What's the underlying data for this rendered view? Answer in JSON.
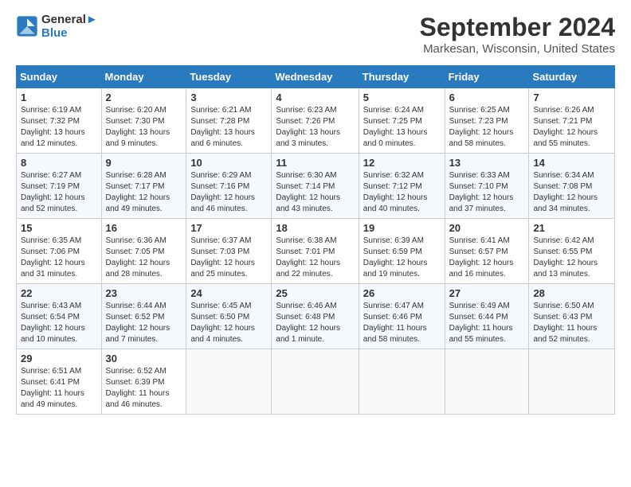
{
  "header": {
    "logo_line1": "General",
    "logo_line2": "Blue",
    "month_year": "September 2024",
    "location": "Markesan, Wisconsin, United States"
  },
  "weekdays": [
    "Sunday",
    "Monday",
    "Tuesday",
    "Wednesday",
    "Thursday",
    "Friday",
    "Saturday"
  ],
  "weeks": [
    [
      {
        "day": "1",
        "info": "Sunrise: 6:19 AM\nSunset: 7:32 PM\nDaylight: 13 hours\nand 12 minutes."
      },
      {
        "day": "2",
        "info": "Sunrise: 6:20 AM\nSunset: 7:30 PM\nDaylight: 13 hours\nand 9 minutes."
      },
      {
        "day": "3",
        "info": "Sunrise: 6:21 AM\nSunset: 7:28 PM\nDaylight: 13 hours\nand 6 minutes."
      },
      {
        "day": "4",
        "info": "Sunrise: 6:23 AM\nSunset: 7:26 PM\nDaylight: 13 hours\nand 3 minutes."
      },
      {
        "day": "5",
        "info": "Sunrise: 6:24 AM\nSunset: 7:25 PM\nDaylight: 13 hours\nand 0 minutes."
      },
      {
        "day": "6",
        "info": "Sunrise: 6:25 AM\nSunset: 7:23 PM\nDaylight: 12 hours\nand 58 minutes."
      },
      {
        "day": "7",
        "info": "Sunrise: 6:26 AM\nSunset: 7:21 PM\nDaylight: 12 hours\nand 55 minutes."
      }
    ],
    [
      {
        "day": "8",
        "info": "Sunrise: 6:27 AM\nSunset: 7:19 PM\nDaylight: 12 hours\nand 52 minutes."
      },
      {
        "day": "9",
        "info": "Sunrise: 6:28 AM\nSunset: 7:17 PM\nDaylight: 12 hours\nand 49 minutes."
      },
      {
        "day": "10",
        "info": "Sunrise: 6:29 AM\nSunset: 7:16 PM\nDaylight: 12 hours\nand 46 minutes."
      },
      {
        "day": "11",
        "info": "Sunrise: 6:30 AM\nSunset: 7:14 PM\nDaylight: 12 hours\nand 43 minutes."
      },
      {
        "day": "12",
        "info": "Sunrise: 6:32 AM\nSunset: 7:12 PM\nDaylight: 12 hours\nand 40 minutes."
      },
      {
        "day": "13",
        "info": "Sunrise: 6:33 AM\nSunset: 7:10 PM\nDaylight: 12 hours\nand 37 minutes."
      },
      {
        "day": "14",
        "info": "Sunrise: 6:34 AM\nSunset: 7:08 PM\nDaylight: 12 hours\nand 34 minutes."
      }
    ],
    [
      {
        "day": "15",
        "info": "Sunrise: 6:35 AM\nSunset: 7:06 PM\nDaylight: 12 hours\nand 31 minutes."
      },
      {
        "day": "16",
        "info": "Sunrise: 6:36 AM\nSunset: 7:05 PM\nDaylight: 12 hours\nand 28 minutes."
      },
      {
        "day": "17",
        "info": "Sunrise: 6:37 AM\nSunset: 7:03 PM\nDaylight: 12 hours\nand 25 minutes."
      },
      {
        "day": "18",
        "info": "Sunrise: 6:38 AM\nSunset: 7:01 PM\nDaylight: 12 hours\nand 22 minutes."
      },
      {
        "day": "19",
        "info": "Sunrise: 6:39 AM\nSunset: 6:59 PM\nDaylight: 12 hours\nand 19 minutes."
      },
      {
        "day": "20",
        "info": "Sunrise: 6:41 AM\nSunset: 6:57 PM\nDaylight: 12 hours\nand 16 minutes."
      },
      {
        "day": "21",
        "info": "Sunrise: 6:42 AM\nSunset: 6:55 PM\nDaylight: 12 hours\nand 13 minutes."
      }
    ],
    [
      {
        "day": "22",
        "info": "Sunrise: 6:43 AM\nSunset: 6:54 PM\nDaylight: 12 hours\nand 10 minutes."
      },
      {
        "day": "23",
        "info": "Sunrise: 6:44 AM\nSunset: 6:52 PM\nDaylight: 12 hours\nand 7 minutes."
      },
      {
        "day": "24",
        "info": "Sunrise: 6:45 AM\nSunset: 6:50 PM\nDaylight: 12 hours\nand 4 minutes."
      },
      {
        "day": "25",
        "info": "Sunrise: 6:46 AM\nSunset: 6:48 PM\nDaylight: 12 hours\nand 1 minute."
      },
      {
        "day": "26",
        "info": "Sunrise: 6:47 AM\nSunset: 6:46 PM\nDaylight: 11 hours\nand 58 minutes."
      },
      {
        "day": "27",
        "info": "Sunrise: 6:49 AM\nSunset: 6:44 PM\nDaylight: 11 hours\nand 55 minutes."
      },
      {
        "day": "28",
        "info": "Sunrise: 6:50 AM\nSunset: 6:43 PM\nDaylight: 11 hours\nand 52 minutes."
      }
    ],
    [
      {
        "day": "29",
        "info": "Sunrise: 6:51 AM\nSunset: 6:41 PM\nDaylight: 11 hours\nand 49 minutes."
      },
      {
        "day": "30",
        "info": "Sunrise: 6:52 AM\nSunset: 6:39 PM\nDaylight: 11 hours\nand 46 minutes."
      },
      {
        "day": "",
        "info": ""
      },
      {
        "day": "",
        "info": ""
      },
      {
        "day": "",
        "info": ""
      },
      {
        "day": "",
        "info": ""
      },
      {
        "day": "",
        "info": ""
      }
    ]
  ]
}
